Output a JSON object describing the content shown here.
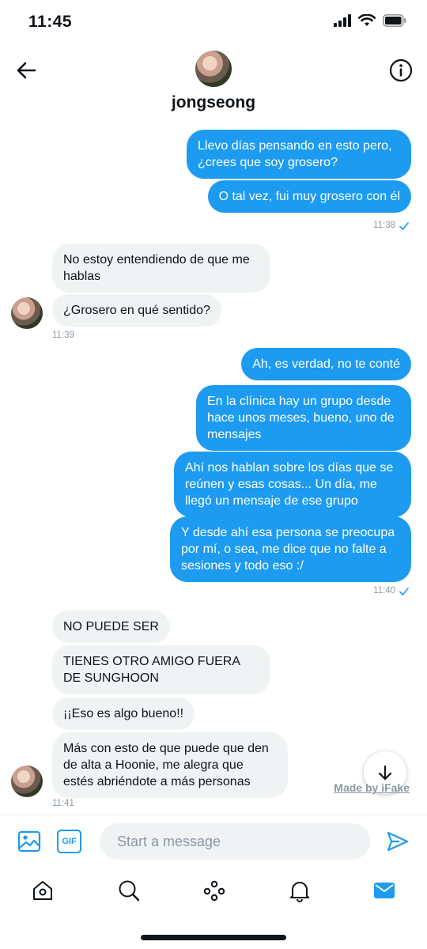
{
  "status_bar": {
    "time": "11:45"
  },
  "conversation": {
    "name": "jongseong"
  },
  "messages": [
    {
      "dir": "out",
      "text": "Llevo días pensando en esto pero, ¿crees que soy grosero?"
    },
    {
      "dir": "out",
      "text": "O tal vez, fui muy grosero con él"
    },
    {
      "dir": "in",
      "text": "No estoy entendiendo de que me hablas"
    },
    {
      "dir": "in",
      "text": "¿Grosero en qué sentido?"
    },
    {
      "dir": "out",
      "text": "Ah, es verdad, no te conté"
    },
    {
      "dir": "out",
      "text": "En la clínica hay un grupo desde hace unos meses, bueno, uno de mensajes"
    },
    {
      "dir": "out",
      "text": "Ahí nos hablan sobre los días que se reúnen y esas cosas... Un día, me llegó un mensaje de ese grupo"
    },
    {
      "dir": "out",
      "text": "Y desde ahí esa persona se preocupa por mí, o sea, me dice que no falte a sesiones y todo eso :/"
    },
    {
      "dir": "in",
      "text": "NO PUEDE SER"
    },
    {
      "dir": "in",
      "text": "TIENES OTRO AMIGO FUERA DE SUNGHOON"
    },
    {
      "dir": "in",
      "text": "¡¡Eso es algo bueno!!"
    },
    {
      "dir": "in",
      "text": "Más con esto de que puede que den de alta a Hoonie, me alegra que estés abriéndote a más personas"
    }
  ],
  "timestamps": [
    "11:38",
    "11:39",
    "11:40",
    "11:41"
  ],
  "watermark": "Made by iFake",
  "composer": {
    "placeholder": "Start a message",
    "gif_label": "GIF"
  },
  "icons": {
    "back": "arrow-left-icon",
    "info": "info-icon",
    "image": "image-icon",
    "gif": "gif-icon",
    "send": "send-icon",
    "home": "home-icon",
    "search": "search-icon",
    "spaces": "spaces-icon",
    "notifications": "bell-icon",
    "messages": "mail-icon"
  },
  "colors": {
    "accent": "#1d9bf0",
    "incoming_bubble": "#eff3f4",
    "text": "#0f1419",
    "muted": "#8b98a5"
  }
}
